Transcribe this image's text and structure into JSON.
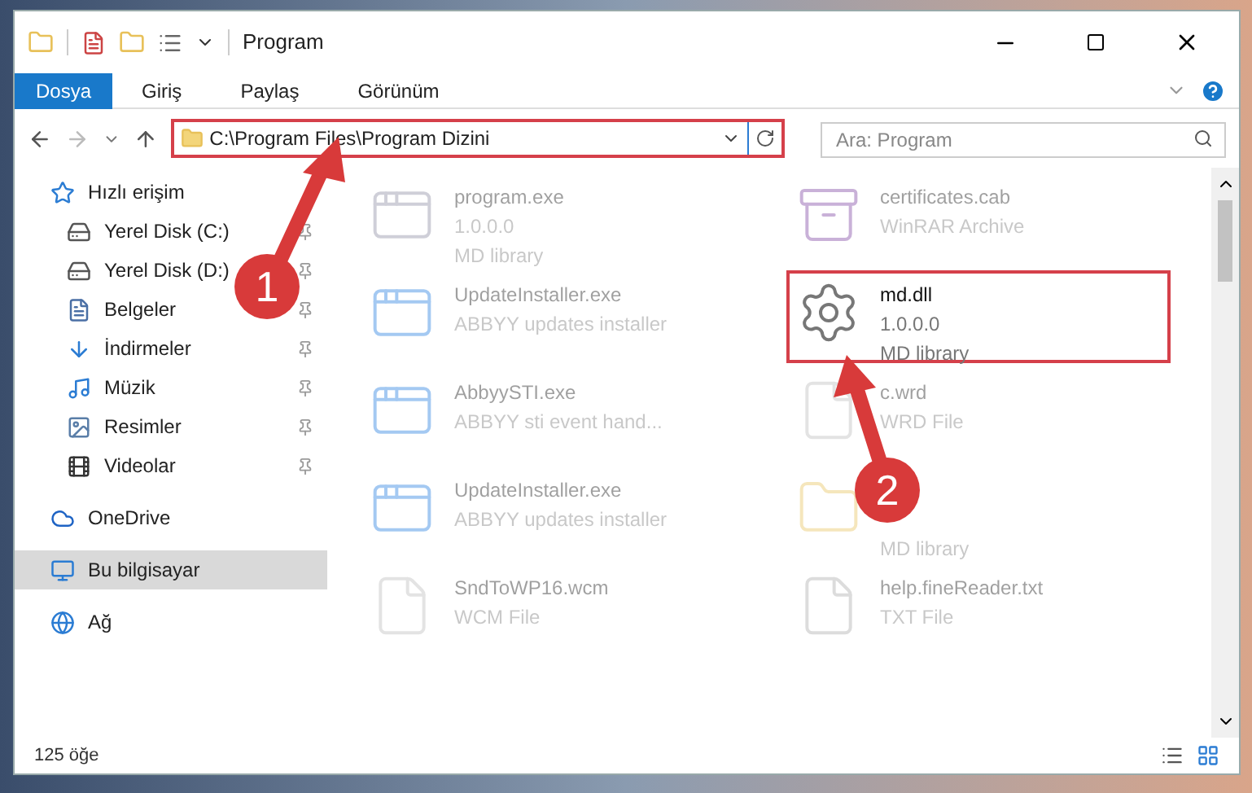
{
  "window": {
    "title": "Program"
  },
  "ribbon_tabs": [
    {
      "label": "Dosya",
      "selected": true
    },
    {
      "label": "Giriş",
      "selected": false
    },
    {
      "label": "Paylaş",
      "selected": false
    },
    {
      "label": "Görünüm",
      "selected": false
    }
  ],
  "address_bar": {
    "path": "C:\\Program Files\\Program Dizini",
    "highlighted": true
  },
  "search": {
    "placeholder": "Ara: Program"
  },
  "sidebar": {
    "items": [
      {
        "label": "Hızlı erişim",
        "kind": "star",
        "pinned": false,
        "selected": false,
        "children": [
          {
            "label": "Yerel Disk (C:)",
            "kind": "drive",
            "pinned": true,
            "selected": false
          },
          {
            "label": "Yerel Disk (D:)",
            "kind": "drive",
            "pinned": true,
            "selected": false
          },
          {
            "label": "Belgeler",
            "kind": "document",
            "pinned": true,
            "selected": false
          },
          {
            "label": "İndirmeler",
            "kind": "download",
            "pinned": true,
            "selected": false
          },
          {
            "label": "Müzik",
            "kind": "music",
            "pinned": true,
            "selected": false
          },
          {
            "label": "Resimler",
            "kind": "pictures",
            "pinned": true,
            "selected": false
          },
          {
            "label": "Videolar",
            "kind": "video",
            "pinned": true,
            "selected": false
          }
        ]
      },
      {
        "label": "OneDrive",
        "kind": "cloud",
        "pinned": false,
        "selected": false
      },
      {
        "label": "Bu bilgisayar",
        "kind": "computer",
        "pinned": false,
        "selected": true
      },
      {
        "label": "Ağ",
        "kind": "network",
        "pinned": false,
        "selected": false
      }
    ]
  },
  "files": [
    {
      "name": "program.exe",
      "lines": [
        "1.0.0.0",
        "MD library"
      ],
      "kind": "exe",
      "faded": true,
      "highlighted": false
    },
    {
      "name": "certificates.cab",
      "lines": [
        "WinRAR Archive"
      ],
      "kind": "archive",
      "faded": true,
      "highlighted": false
    },
    {
      "name": "UpdateInstaller.exe",
      "lines": [
        "ABBYY updates installer"
      ],
      "kind": "app",
      "faded": true,
      "highlighted": false
    },
    {
      "name": "md.dll",
      "lines": [
        "1.0.0.0",
        "MD library"
      ],
      "kind": "dll",
      "faded": false,
      "highlighted": true
    },
    {
      "name": "AbbyySTI.exe",
      "lines": [
        "ABBYY sti event hand..."
      ],
      "kind": "app",
      "faded": true,
      "highlighted": false
    },
    {
      "name": "c.wrd",
      "lines": [
        "WRD File"
      ],
      "kind": "blank",
      "faded": true,
      "highlighted": false
    },
    {
      "name": "UpdateInstaller.exe",
      "lines": [
        "ABBYY updates installer"
      ],
      "kind": "app",
      "faded": true,
      "highlighted": false
    },
    {
      "lines": [
        "MD library"
      ],
      "kind": "folder",
      "faded": true,
      "highlighted": false
    },
    {
      "name": "SndToWP16.wcm",
      "lines": [
        "WCM File"
      ],
      "kind": "blank",
      "faded": true,
      "highlighted": false
    },
    {
      "name": "help.fineReader.txt",
      "lines": [
        "TXT File"
      ],
      "kind": "grayfile",
      "faded": true,
      "highlighted": false
    }
  ],
  "status_bar": {
    "count": "125 öğe"
  },
  "annotations": [
    {
      "label": "1"
    },
    {
      "label": "2"
    }
  ]
}
